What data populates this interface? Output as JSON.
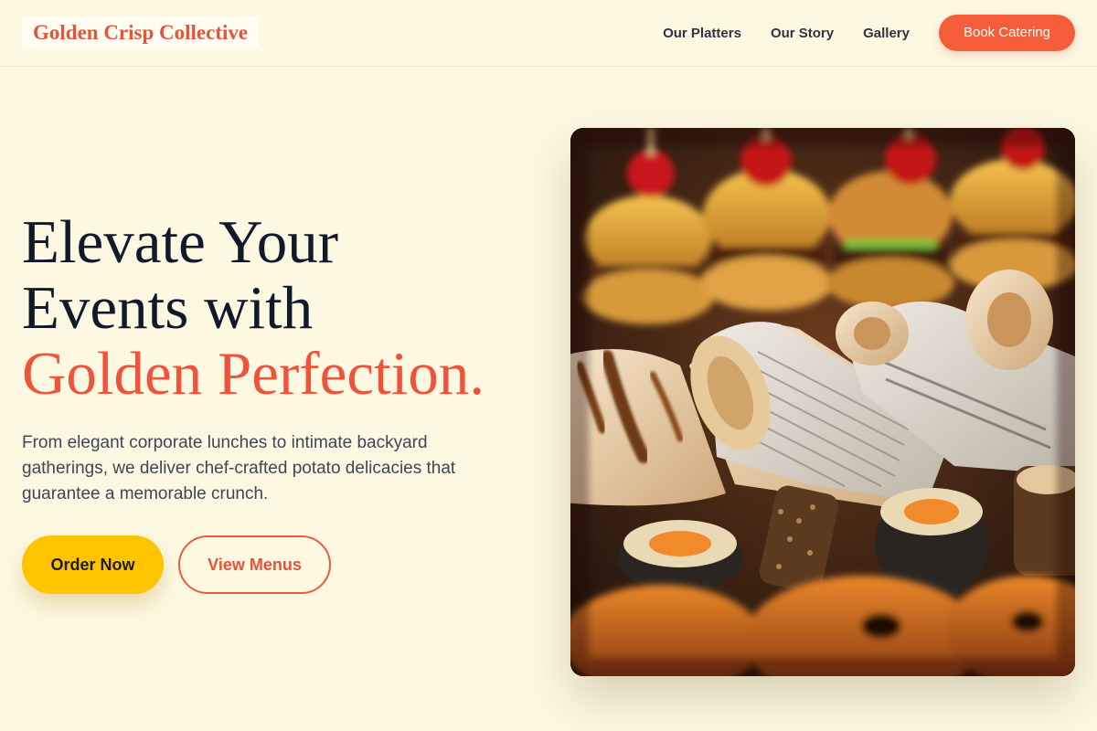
{
  "brand": {
    "logo_text": "Golden Crisp Collective",
    "accent_color": "#f45c3a",
    "cta_color": "#fec400",
    "background_color": "#fdf8e2"
  },
  "nav": {
    "items": [
      {
        "label": "Our Platters"
      },
      {
        "label": "Our Story"
      },
      {
        "label": "Gallery"
      }
    ],
    "cta_label": "Book Catering"
  },
  "hero": {
    "title_line1": "Elevate Your",
    "title_line2": "Events with",
    "title_accent": "Golden Perfection.",
    "description": "From elegant corporate lunches to intimate backyard gatherings, we deliver chef-crafted potato delicacies that guarantee a memorable crunch.",
    "primary_cta": "Order Now",
    "secondary_cta": "View Menus",
    "image_subject": "catering-platter-photo"
  }
}
